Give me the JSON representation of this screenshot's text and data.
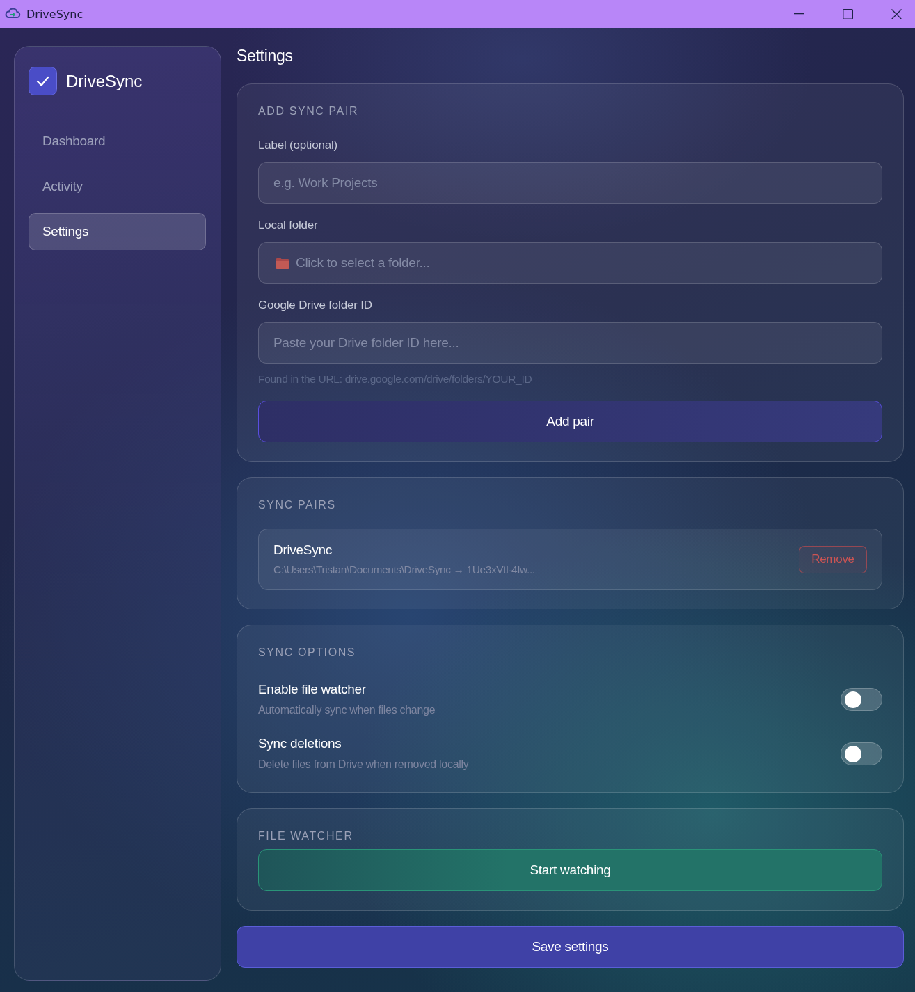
{
  "window": {
    "title": "DriveSync"
  },
  "sidebar": {
    "brand": "DriveSync",
    "items": [
      {
        "label": "Dashboard",
        "selected": false
      },
      {
        "label": "Activity",
        "selected": false
      },
      {
        "label": "Settings",
        "selected": true
      }
    ]
  },
  "page_title": "Settings",
  "add_sync_pair": {
    "title": "ADD SYNC PAIR",
    "fields": [
      {
        "kind": "text",
        "label": "Label (optional)",
        "placeholder": "e.g. Work Projects"
      },
      {
        "kind": "folder",
        "label": "Local folder",
        "placeholder": "Click to select a folder..."
      },
      {
        "kind": "text",
        "label": "Google Drive folder ID",
        "placeholder": "Paste your Drive folder ID here..."
      }
    ],
    "hint": "Found in the URL: drive.google.com/drive/folders/YOUR_ID",
    "button": "Add pair"
  },
  "sync_pairs": {
    "title": "SYNC PAIRS",
    "pairs": [
      {
        "name": "DriveSync",
        "path": "C:\\Users\\Tristan\\Documents\\DriveSync → 1Ue3xVtl-4Iw...",
        "action": "Remove"
      }
    ]
  },
  "sync_options": {
    "title": "SYNC OPTIONS",
    "options": [
      {
        "label": "Enable file watcher",
        "description": "Automatically sync when files change",
        "on": false
      },
      {
        "label": "Sync deletions",
        "description": "Delete files from Drive when removed locally",
        "on": false
      }
    ]
  },
  "file_watcher": {
    "title": "FILE WATCHER",
    "button": "Start watching"
  },
  "save_button": "Save settings"
}
